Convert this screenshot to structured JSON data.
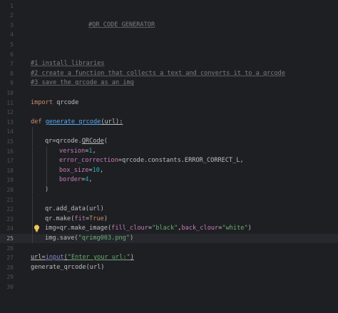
{
  "current_line": 25,
  "line_numbers": [
    "1",
    "2",
    "3",
    "4",
    "5",
    "6",
    "7",
    "8",
    "9",
    "10",
    "11",
    "12",
    "13",
    "14",
    "15",
    "16",
    "17",
    "18",
    "19",
    "20",
    "21",
    "22",
    "23",
    "24",
    "25",
    "26",
    "27",
    "28",
    "29",
    "30"
  ],
  "code": {
    "l3": "#QR CODE GENERATOR",
    "l7": "#1 install libraries",
    "l8": "#2 create a function that collects a text and converts it to a qrcode",
    "l9": "#3 save the qrcode as an img",
    "l11_kw": "import",
    "l11_mod": " qrcode",
    "l13_kw": "def",
    "l13_fn": "generate_qrcode",
    "l13_rest": "(url):",
    "l15_a": "qr=qrcode.",
    "l15_cls": "QRCode",
    "l15_b": "(",
    "l16_p": "version",
    "l16_eq": "=",
    "l16_v": "1",
    "l16_c": ",",
    "l17_p": "error_correction",
    "l17_rest": "=qrcode.constants.ERROR_CORRECT_L,",
    "l18_p": "box_size",
    "l18_eq": "=",
    "l18_v": "10",
    "l18_c": ",",
    "l19_p": "border",
    "l19_eq": "=",
    "l19_v": "4",
    "l19_c": ",",
    "l20": ")",
    "l22": "qr.add_data(url)",
    "l23_a": "qr.make(",
    "l23_p": "fit",
    "l23_eq": "=",
    "l23_v": "True",
    "l23_b": ")",
    "l24_a": "img=qr.make_image(",
    "l24_p1": "fill_clour",
    "l24_eq1": "=",
    "l24_s1": "\"black\"",
    "l24_c": ",",
    "l24_p2": "back_clour",
    "l24_eq2": "=",
    "l24_s2": "\"white\"",
    "l24_b": ")",
    "l25_a": "img.save(",
    "l25_s": "\"qrimg003.png\"",
    "l25_b": ")",
    "l27_a": "url=",
    "l27_fn": "input",
    "l27_b": "(",
    "l27_s": "\"Enter your url:\"",
    "l27_c": ")",
    "l28": "generate_qrcode(url)"
  },
  "colors": {
    "background": "#1e1f22",
    "comment": "#7a7e85",
    "keyword": "#cf8e6d",
    "function": "#56a8f5",
    "parameter": "#c77dbb",
    "number": "#2aacb8",
    "string": "#6aab73",
    "builtin": "#8888c6",
    "text": "#bcbec4",
    "current_line": "#26282e"
  },
  "icons": {
    "intention": "lightbulb-icon"
  }
}
